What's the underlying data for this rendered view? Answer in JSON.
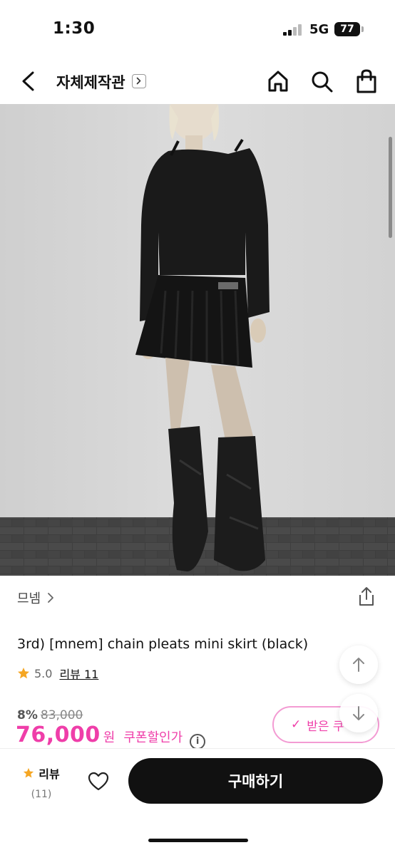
{
  "status_bar": {
    "time": "1:30",
    "network": "5G",
    "battery": "77"
  },
  "header": {
    "shop_title": "자체제작관",
    "icons": [
      "back-icon",
      "chevron-right-icon",
      "home-icon",
      "search-icon",
      "shopping-bag-icon"
    ]
  },
  "product": {
    "brand": "므넴",
    "title": "3rd) [mnem] chain pleats mini skirt (black)",
    "rating": "5.0",
    "review_label": "리뷰 11",
    "discount": "8%",
    "original_price": "83,000",
    "price": "76,000",
    "currency": "원",
    "coupon_price_label": "쿠폰할인가",
    "info_symbol": "i",
    "coupon_button": "받은 쿠",
    "coupon_check": "✓"
  },
  "colors": {
    "accent": "#ef3ea9",
    "star": "#f5a623",
    "buy_button": "#111111"
  },
  "bottom_bar": {
    "review_label": "리뷰",
    "review_count": "(11)",
    "buy_label": "구매하기"
  }
}
